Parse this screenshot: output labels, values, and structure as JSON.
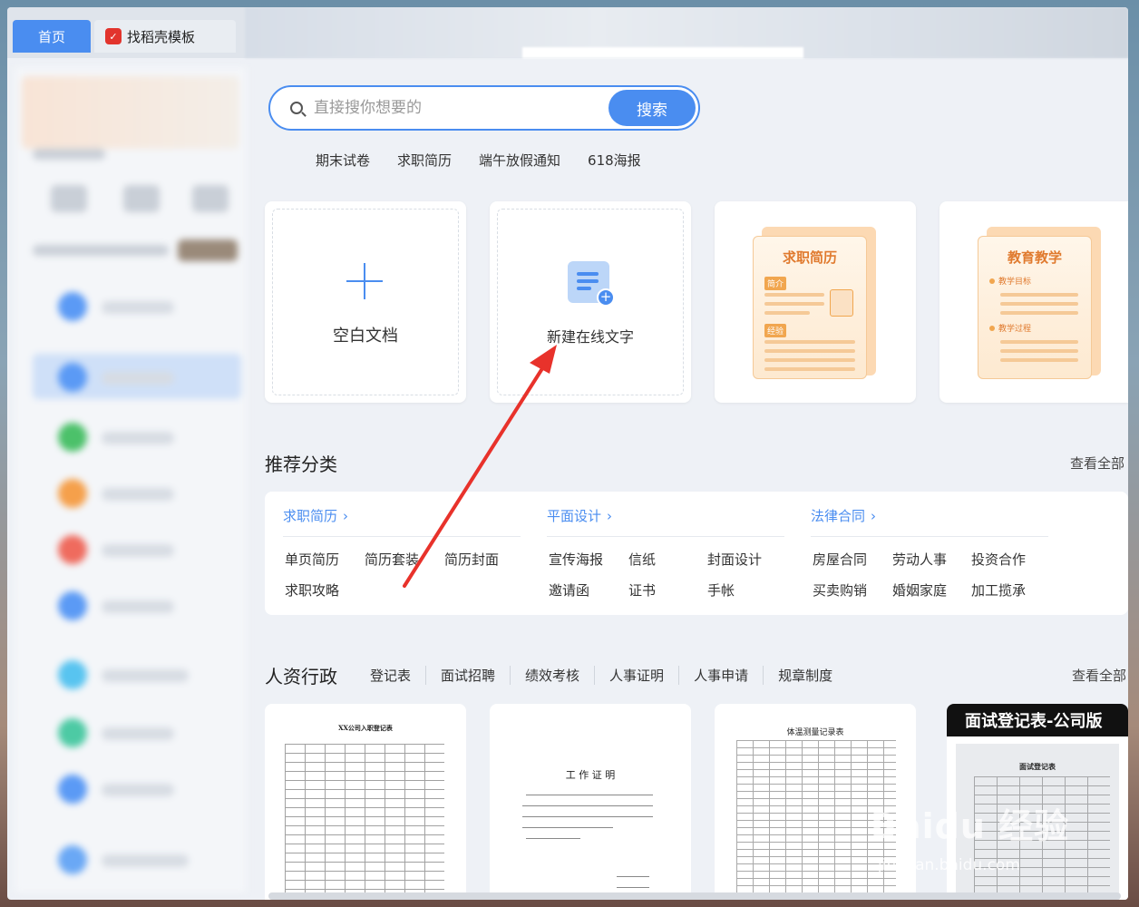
{
  "tabs": {
    "home": "首页",
    "template": "找稻壳模板"
  },
  "search": {
    "placeholder": "直接搜你想要的",
    "button": "搜索",
    "hot_tags": [
      "期末试卷",
      "求职简历",
      "端午放假通知",
      "618海报"
    ]
  },
  "quick_cards": {
    "blank": "空白文档",
    "online": "新建在线文字",
    "resume": {
      "title": "求职简历",
      "tag1": "简介",
      "tag2": "经验"
    },
    "education": {
      "title": "教育教学",
      "sub1": "教学目标",
      "sub2": "教学过程"
    }
  },
  "recommend": {
    "title": "推荐分类",
    "see_all": "查看全部",
    "columns": [
      {
        "head": "求职简历",
        "items": [
          "单页简历",
          "简历套装",
          "简历封面",
          "求职攻略"
        ]
      },
      {
        "head": "平面设计",
        "items": [
          "宣传海报",
          "信纸",
          "封面设计",
          "邀请函",
          "证书",
          "手帐"
        ]
      },
      {
        "head": "法律合同",
        "items": [
          "房屋合同",
          "劳动人事",
          "投资合作",
          "买卖购销",
          "婚姻家庭",
          "加工揽承"
        ]
      }
    ]
  },
  "hr": {
    "title": "人资行政",
    "see_all": "查看全部",
    "tabs": [
      "登记表",
      "面试招聘",
      "绩效考核",
      "人事证明",
      "人事申请",
      "规章制度"
    ],
    "docs": [
      {
        "title": "XX公司入职登记表"
      },
      {
        "title": "工 作 证 明"
      },
      {
        "title": "体温测量记录表"
      },
      {
        "banner": "面试登记表-公司版",
        "title": "面试登记表"
      }
    ]
  },
  "watermark": {
    "main": "Baidu 经验",
    "sub": "jingyan.baidu.com"
  },
  "colors": {
    "accent": "#4a8df0",
    "arrow": "#e8322b"
  }
}
